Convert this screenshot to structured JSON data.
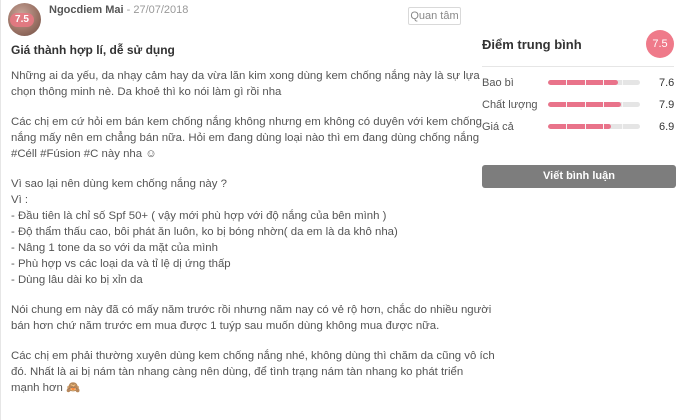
{
  "review": {
    "author": "Ngocdiem Mai",
    "date": " - 27/07/2018",
    "avatar_score": "7.5",
    "follow_label": "Quan tâm",
    "title": "Giá thành hợp lí, dễ sử dụng",
    "paragraphs": [
      [
        "Những ai da yếu, da nhạy cảm hay da vừa lăn kim xong dùng kem chống nắng này là sự lựa",
        "chọn thông minh nè. Da khoẻ thì ko nói làm gì rồi nha"
      ],
      [
        "Các chị em cứ hỏi em bán kem chống nắng không nhưng em không có duyên với kem chống",
        "nắng mấy nên em chẳng bán nữa. Hỏi em đang dùng loại nào thì em đang dùng chống nắng",
        "#Céll #Fúsion #C này nha ☺"
      ],
      [
        "Vì sao lại nên dùng kem chống nắng này ?",
        "Vì :",
        "- Đầu tiên là chỉ số Spf 50+ ( vậy mới phù hợp với độ nắng của bên mình )",
        "- Độ thẩm thấu cao, bôi phát ăn luôn, ko bị bóng nhờn( da em là da khô nha)",
        "- Nâng 1 tone da so với da mặt của mình",
        "- Phù hợp vs các loại da và tỉ lệ dị ứng thấp",
        "- Dùng lâu dài ko bị xỉn da"
      ],
      [
        "Nói chung em này đã có mấy năm trước rồi nhưng năm nay có vẻ rộ hơn, chắc do nhiều người",
        "bán hơn chứ năm trước em mua được 1 tuýp sau muốn dùng không mua được nữa."
      ],
      [
        "Các chị em phải thường xuyên dùng kem chống nắng nhé, không dùng thì chăm da cũng vô ích",
        "đó. Nhất là ai bị nám tàn nhang càng nên dùng, để tình trạng nám tàn nhang ko phát triển",
        "mạnh hơn 🙈"
      ]
    ]
  },
  "scores": {
    "title": "Điểm trung bình",
    "overall": "7.5",
    "items": [
      {
        "label": "Bao bì",
        "value": "7.6",
        "fraction": 0.76
      },
      {
        "label": "Chất lượng",
        "value": "7.9",
        "fraction": 0.79
      },
      {
        "label": "Giá cả",
        "value": "6.9",
        "fraction": 0.69
      }
    ],
    "write_label": "Viết bình luận"
  },
  "colors": {
    "accent": "#ef7a8a",
    "bar_fill": "#e9738a",
    "button": "#7d7d7d"
  }
}
